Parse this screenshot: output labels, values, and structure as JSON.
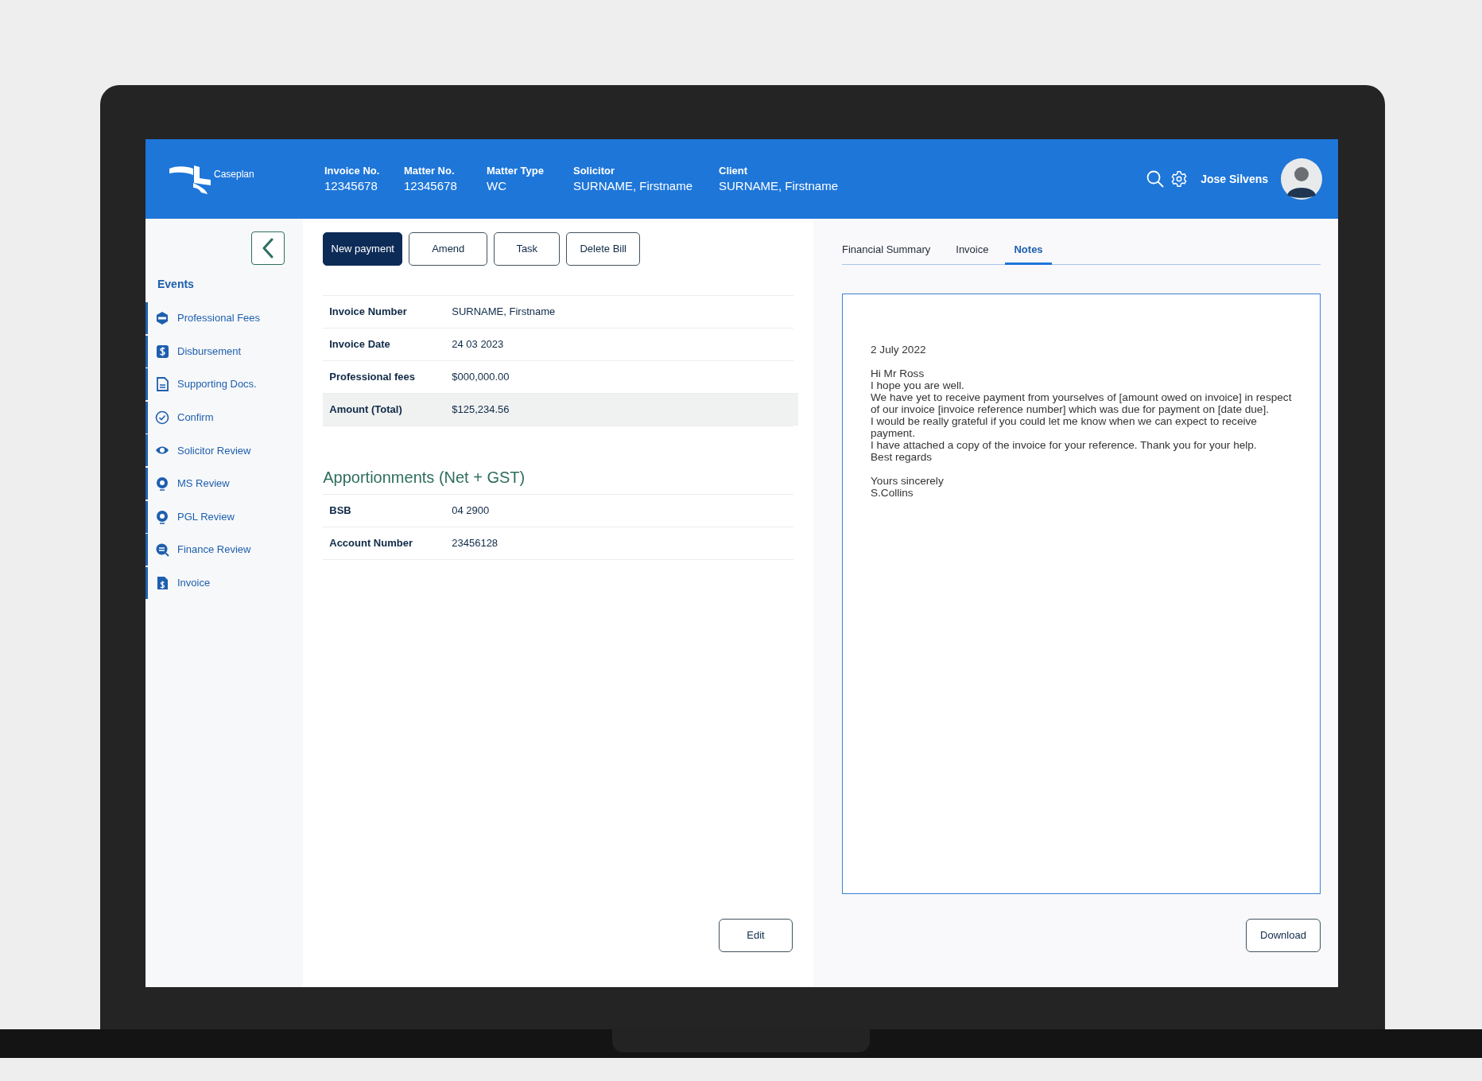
{
  "header": {
    "brand": "Caseplan",
    "fields": [
      {
        "label": "Invoice No.",
        "value": "12345678"
      },
      {
        "label": "Matter No.",
        "value": "12345678"
      },
      {
        "label": "Matter Type",
        "value": "WC"
      },
      {
        "label": "Solicitor",
        "value": "SURNAME, Firstname"
      },
      {
        "label": "Client",
        "value": "SURNAME, Firstname"
      }
    ],
    "user": "Jose Silvens"
  },
  "sidebar": {
    "title": "Events",
    "items": [
      {
        "label": "Professional Fees"
      },
      {
        "label": "Disbursement"
      },
      {
        "label": "Supporting Docs."
      },
      {
        "label": "Confirm"
      },
      {
        "label": "Solicitor Review"
      },
      {
        "label": "MS Review"
      },
      {
        "label": "PGL Review"
      },
      {
        "label": "Finance Review"
      },
      {
        "label": "Invoice"
      }
    ]
  },
  "actions": [
    {
      "label": "New payment",
      "kind": "primary"
    },
    {
      "label": "Amend",
      "kind": "outline"
    },
    {
      "label": "Task",
      "kind": "outline"
    },
    {
      "label": "Delete Bill",
      "kind": "outline"
    }
  ],
  "invoice_rows": [
    {
      "label": "Invoice Number",
      "value": "SURNAME, Firstname",
      "highlighted": false
    },
    {
      "label": "Invoice Date",
      "value": "24 03 2023",
      "highlighted": false
    },
    {
      "label": "Professional fees",
      "value": "$000,000.00",
      "highlighted": false
    },
    {
      "label": "Amount (Total)",
      "value": "$125,234.56",
      "highlighted": true
    }
  ],
  "apportionments": {
    "title": "Apportionments (Net + GST)",
    "rows": [
      {
        "label": "BSB",
        "value": "04 2900"
      },
      {
        "label": "Account Number",
        "value": "23456128"
      }
    ]
  },
  "edit_button": "Edit",
  "tabs": [
    {
      "label": "Financial Summary",
      "selected": false
    },
    {
      "label": "Invoice",
      "selected": false
    },
    {
      "label": "Notes",
      "selected": true
    }
  ],
  "notes": {
    "paragraphs": [
      [
        "2 July 2022"
      ],
      [
        "Hi Mr Ross",
        "I hope you are well.",
        "We have yet to receive payment from yourselves of [amount owed on invoice] in respect of our invoice [invoice reference number] which was due for payment on [date due].",
        "I would be really grateful if you could let me know when we can expect to receive payment.",
        "I have attached a copy of the invoice for your reference. Thank you for your help.",
        "Best regards"
      ],
      [
        "Yours sincerely",
        "S.Collins"
      ]
    ]
  },
  "download_button": "Download"
}
